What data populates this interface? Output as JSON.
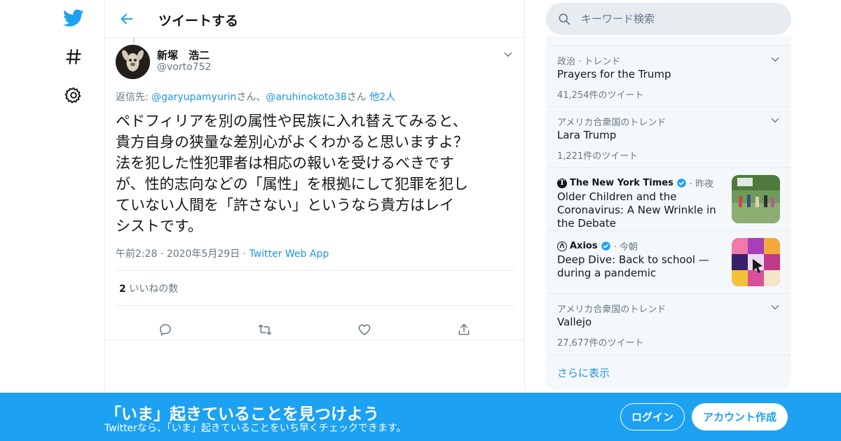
{
  "colors": {
    "accent": "#1da1f2",
    "link": "#1b95e0",
    "muted": "#657786",
    "border": "#e6ecf0"
  },
  "nav": {
    "icons": [
      "twitter-logo-icon",
      "hashtag-icon",
      "gear-icon"
    ]
  },
  "header": {
    "title": "ツイートする"
  },
  "tweet": {
    "author_name": "新塚　浩二",
    "author_handle": "@vorto752",
    "reply_prefix": "返信先: ",
    "reply_user1": "@garyupamyurin",
    "reply_san1": "さん、",
    "reply_user2": "@aruhinokoto38",
    "reply_san2": "さん",
    "reply_others": "他2人",
    "text": "ペドフィリアを別の属性や民族に入れ替えてみると、\n貴方自身の狭量な差別心がよくわかると思いますよ？\n法を犯した性犯罪者は相応の報いを受けるべきです\nが、性的志向などの「属性」を根拠にして犯罪を犯し\nていない人間を「許さない」というなら貴方はレイ\nシストです。",
    "time": "午前2:28",
    "date": "2020年5月29日",
    "source": "Twitter Web App",
    "dot": "·",
    "likes_count": "2",
    "likes_label": "いいねの数"
  },
  "search": {
    "placeholder": "キーワード検索"
  },
  "trends": {
    "items": [
      {
        "context": "政治 · トレンド",
        "name": "Prayers for the Trump",
        "count": "41,254件のツイート"
      },
      {
        "context": "アメリカ合衆国のトレンド",
        "name": "Lara Trump",
        "count": "1,221件のツイート"
      },
      {
        "context": "アメリカ合衆国のトレンド",
        "name": "Vallejo",
        "count": "27,677件のツイート"
      }
    ],
    "news": [
      {
        "source": "The New York Times",
        "time": "· 昨夜",
        "title": "Older Children and the Coronavirus: A New Wrinkle in the Debate"
      },
      {
        "source": "Axios",
        "time": "· 今朝",
        "title": "Deep Dive: Back to school — during a pandemic"
      }
    ],
    "show_more": "さらに表示"
  },
  "bottom_bar": {
    "title": "「いま」起きていることを見つけよう",
    "subtitle": "Twitterなら、「いま」起きていることをいち早くチェックできます。",
    "login": "ログイン",
    "signup": "アカウント作成"
  }
}
